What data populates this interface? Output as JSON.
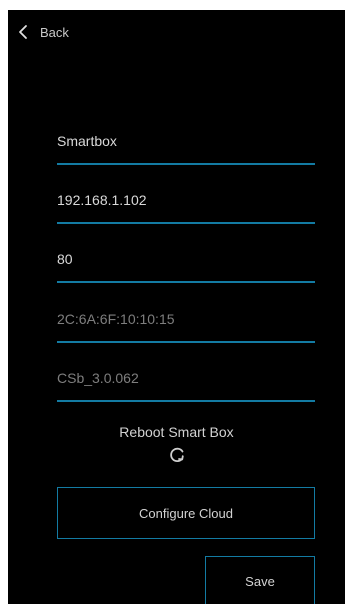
{
  "nav": {
    "back_label": "Back",
    "back_icon": "chevron-left-icon"
  },
  "fields": {
    "name": "Smartbox",
    "ip_address": "192.168.1.102",
    "port": "80",
    "mac_address": "2C:6A:6F:10:10:15",
    "firmware": "CSb_3.0.062"
  },
  "reboot": {
    "label": "Reboot Smart Box",
    "icon": "refresh-icon"
  },
  "buttons": {
    "configure_cloud": "Configure Cloud",
    "save": "Save"
  },
  "colors": {
    "background": "#000000",
    "accent": "#137ba3",
    "text": "#d9d9d9",
    "text_disabled": "#7e7e7e"
  }
}
